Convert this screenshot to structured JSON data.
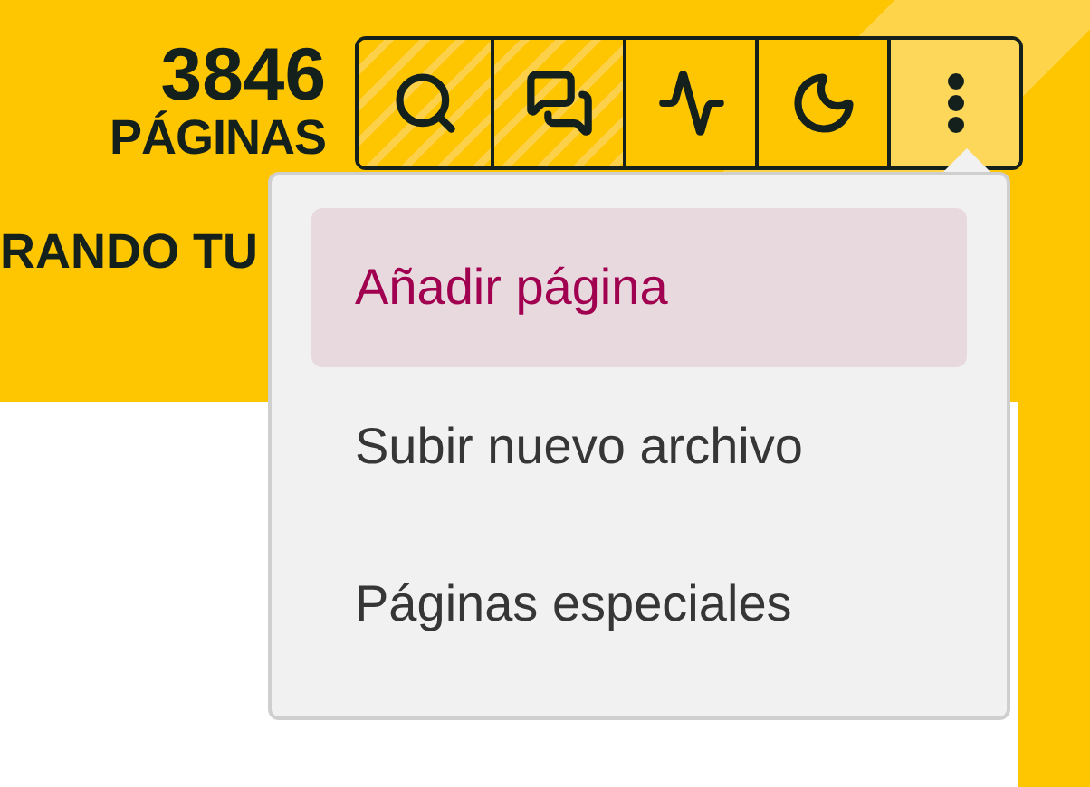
{
  "stats": {
    "count": "3846",
    "label": "PÁGINAS"
  },
  "banner_text": "RANDO TU",
  "more_menu": {
    "expanded": true,
    "items": [
      {
        "label": "Añadir página",
        "selected": true
      },
      {
        "label": "Subir nuevo archivo",
        "selected": false
      },
      {
        "label": "Páginas especiales",
        "selected": false
      }
    ]
  }
}
